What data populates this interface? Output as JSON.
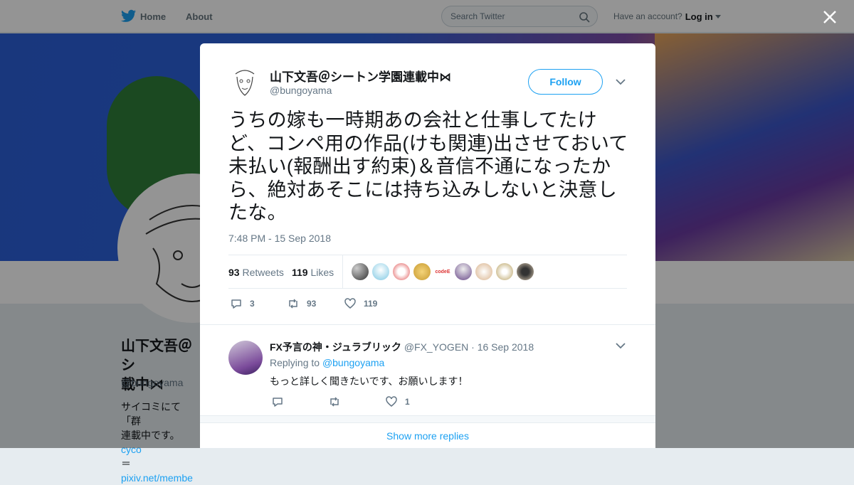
{
  "nav": {
    "home": "Home",
    "about": "About",
    "search_placeholder": "Search Twitter",
    "have_account": "Have an account?",
    "login": "Log in"
  },
  "profile": {
    "name": "山下文吾＠シ…載中⋈",
    "name_line1": "山下文吾＠シ",
    "name_line2": "載中⋈",
    "handle": "@bungoyama",
    "bio_line1": "サイコミにて「群",
    "bio_line2": "連載中です。",
    "bio_link1": "cyco",
    "bio_line3": "＝",
    "bio_link2": "pixiv.net/membe"
  },
  "tweet": {
    "author_name": "山下文吾＠シートン学園連載中⋈",
    "author_handle": "@bungoyama",
    "follow_label": "Follow",
    "text": "うちの嫁も一時期あの会社と仕事してたけど、コンペ用の作品(けも関連)出させておいて未払い(報酬出す約束)＆音信不通になったから、絶対あそこには持ち込みしないと決意したな。",
    "timestamp": "7:48 PM - 15 Sep 2018",
    "retweets_count": "93",
    "retweets_label": "Retweets",
    "likes_count": "119",
    "likes_label": "Likes",
    "likers": [
      "#5a5a5a",
      "#7ec8e3",
      "#e05050",
      "#e0b24a",
      "#ffffff",
      "#6a4a8a",
      "#d9b38c",
      "#b8a060",
      "#8a6a4a"
    ],
    "likers_text_badge": "codeE",
    "actions": {
      "replies": "3",
      "retweets": "93",
      "likes": "119"
    }
  },
  "reply": {
    "author_name": "FX予言の神・ジュラブリック",
    "author_handle": "@FX_YOGEN",
    "date": "· 16 Sep 2018",
    "replying_to_label": "Replying to",
    "replying_to_handle": "@bungoyama",
    "text": "もっと詳しく聞きたいです、お願いします！",
    "likes": "1"
  },
  "show_more": "Show more replies",
  "colors": {
    "accent": "#1da1f2",
    "text": "#14171a",
    "muted": "#657786"
  }
}
